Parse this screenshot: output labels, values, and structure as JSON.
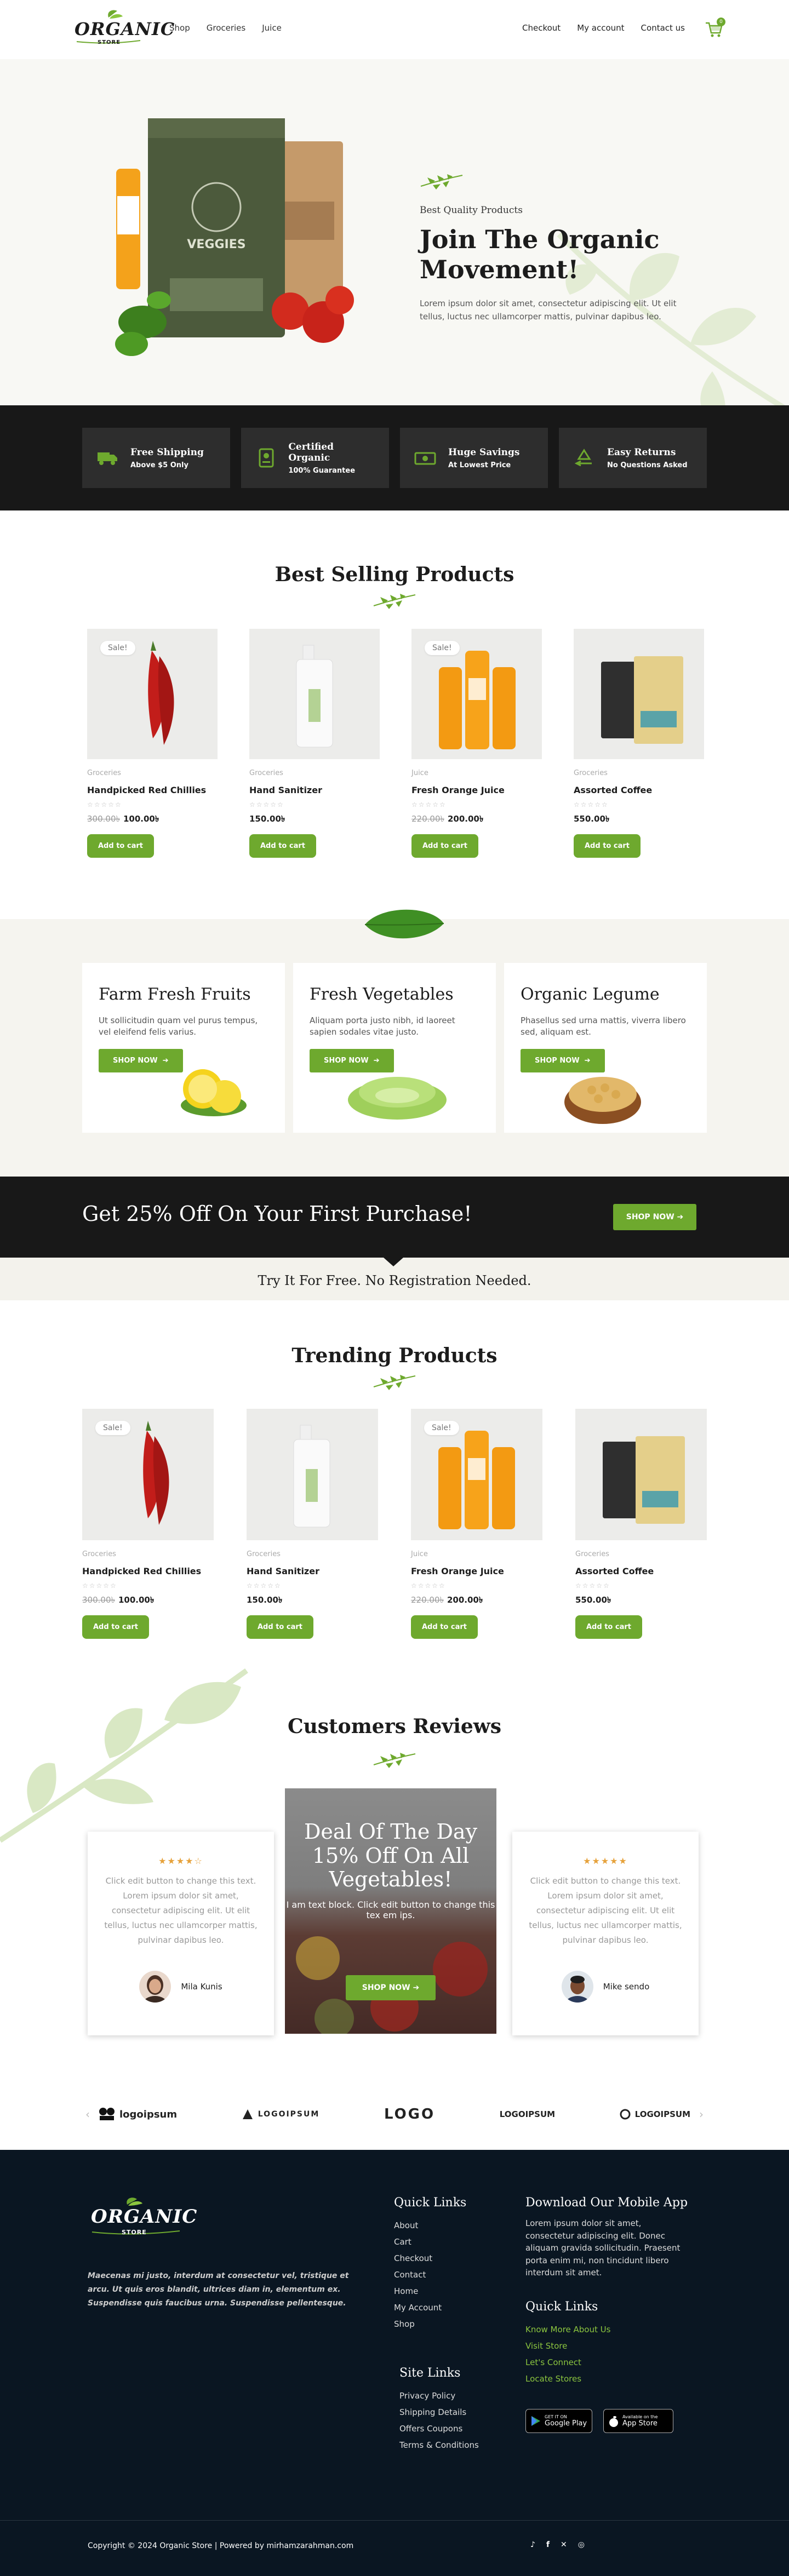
{
  "header": {
    "logo": "ORGANIC",
    "logo_sub": "STORE",
    "nav_left": [
      "Shop",
      "Groceries",
      "Juice"
    ],
    "nav_right": [
      "Checkout",
      "My account",
      "Contact us"
    ],
    "cart_count": "0"
  },
  "hero": {
    "kicker": "Best Quality Products",
    "title": "Join The Organic Movement!",
    "description": "Lorem ipsum dolor sit amet, consectetur adipiscing elit. Ut elit tellus, luctus nec ullamcorper mattis, pulvinar dapibus leo."
  },
  "features": [
    {
      "title": "Free Shipping",
      "sub": "Above $5 Only",
      "icon": "truck-icon"
    },
    {
      "title": "Certified Organic",
      "sub": "100% Guarantee",
      "icon": "certificate-icon"
    },
    {
      "title": "Huge Savings",
      "sub": "At Lowest Price",
      "icon": "money-icon"
    },
    {
      "title": "Easy Returns",
      "sub": "No Questions Asked",
      "icon": "recycle-icon"
    }
  ],
  "best_selling": {
    "title": "Best Selling Products",
    "products": [
      {
        "category": "Groceries",
        "name": "Handpicked Red Chillies",
        "old_price": "300.00৳",
        "price": "100.00৳",
        "sale": "Sale!",
        "stars": "☆☆☆☆☆",
        "button": "Add to cart"
      },
      {
        "category": "Groceries",
        "name": "Hand Sanitizer",
        "old_price": "",
        "price": "150.00৳",
        "sale": "",
        "stars": "☆☆☆☆☆",
        "button": "Add to cart"
      },
      {
        "category": "Juice",
        "name": "Fresh Orange Juice",
        "old_price": "220.00৳",
        "price": "200.00৳",
        "sale": "Sale!",
        "stars": "☆☆☆☆☆",
        "button": "Add to cart"
      },
      {
        "category": "Groceries",
        "name": "Assorted Coffee",
        "old_price": "",
        "price": "550.00৳",
        "sale": "",
        "stars": "☆☆☆☆☆",
        "button": "Add to cart"
      }
    ]
  },
  "categories": [
    {
      "title": "Farm Fresh Fruits",
      "desc": "Ut sollicitudin quam vel purus tempus, vel eleifend felis varius.",
      "button": "SHOP NOW"
    },
    {
      "title": "Fresh Vegetables",
      "desc": "Aliquam porta justo nibh, id laoreet sapien sodales vitae justo.",
      "button": "SHOP NOW"
    },
    {
      "title": "Organic Legume",
      "desc": "Phasellus sed urna mattis, viverra libero sed, aliquam est.",
      "button": "SHOP NOW"
    }
  ],
  "promo": {
    "title": "Get 25% Off On Your First Purchase!",
    "button": "SHOP NOW",
    "try": "Try It For Free. No Registration Needed."
  },
  "trending": {
    "title": "Trending Products",
    "products": [
      {
        "category": "Groceries",
        "name": "Handpicked Red Chillies",
        "old_price": "300.00৳",
        "price": "100.00৳",
        "sale": "Sale!",
        "stars": "☆☆☆☆☆",
        "button": "Add to cart"
      },
      {
        "category": "Groceries",
        "name": "Hand Sanitizer",
        "old_price": "",
        "price": "150.00৳",
        "sale": "",
        "stars": "☆☆☆☆☆",
        "button": "Add to cart"
      },
      {
        "category": "Juice",
        "name": "Fresh Orange Juice",
        "old_price": "220.00৳",
        "price": "200.00৳",
        "sale": "Sale!",
        "stars": "☆☆☆☆☆",
        "button": "Add to cart"
      },
      {
        "category": "Groceries",
        "name": "Assorted Coffee",
        "old_price": "",
        "price": "550.00৳",
        "sale": "",
        "stars": "☆☆☆☆☆",
        "button": "Add to cart"
      }
    ]
  },
  "reviews": {
    "title": "Customers Reviews",
    "items": [
      {
        "stars": "★★★★☆",
        "text": "Click edit button to change this text. Lorem ipsum dolor sit amet, consectetur adipiscing elit. Ut elit tellus, luctus nec ullamcorper mattis, pulvinar dapibus leo.",
        "author": "Mila Kunis"
      },
      {
        "stars": "★★★★★",
        "text": "Click edit button to change this text. Lorem ipsum dolor sit amet, consectetur adipiscing elit. Ut elit tellus, luctus nec ullamcorper mattis, pulvinar dapibus leo.",
        "author": "Mike sendo"
      }
    ],
    "deal_title": "Deal Of The Day 15% Off On All Vegetables!",
    "deal_desc": "I am text block. Click edit button to change this tex em ips.",
    "deal_button": "SHOP NOW"
  },
  "logos": [
    "logoipsum",
    "LOGOIPSUM",
    "LOGO",
    "LOGOIPSUM",
    "LOGOIPSUM"
  ],
  "footer": {
    "logo": "ORGANIC",
    "logo_sub": "STORE",
    "desc": "Maecenas mi justo, interdum at consectetur vel, tristique et arcu. Ut quis eros blandit, ultrices diam in, elementum ex. Suspendisse quis faucibus urna. Suspendisse pellentesque.",
    "quick_links_title": "Quick Links",
    "quick_links": [
      "About",
      "Cart",
      "Checkout",
      "Contact",
      "Home",
      "My Account",
      "Shop"
    ],
    "site_links_title": "Site Links",
    "site_links": [
      "Privacy Policy",
      "Shipping Details",
      "Offers Coupons",
      "Terms & Conditions"
    ],
    "app_title": "Download Our Mobile App",
    "app_desc": "Lorem ipsum dolor sit amet, consectetur adipiscing elit. Donec aliquam gravida sollicitudin. Praesent porta enim mi, non tincidunt libero interdum sit amet.",
    "quick_links2_title": "Quick Links",
    "quick_links2": [
      "Know More About Us",
      "Visit Store",
      "Let's Connect",
      "Locate Stores"
    ],
    "google_play": "Google Play",
    "google_play_small": "GET IT ON",
    "app_store": "App Store",
    "app_store_small": "Available on the",
    "copyright": "Copyright © 2024 Organic Store | Powered by mirhamzarahman.com"
  }
}
